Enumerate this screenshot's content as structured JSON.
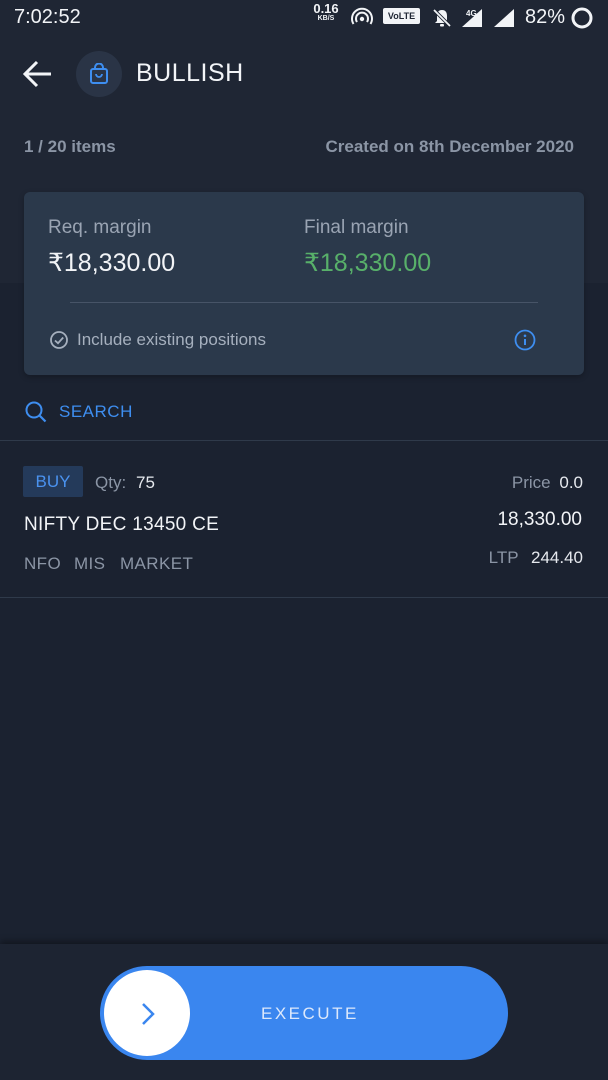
{
  "status_bar": {
    "time": "7:02:52",
    "net_speed_value": "0.16",
    "net_speed_unit": "KB/S",
    "volte": "VoLTE",
    "network_type": "4G",
    "battery_percent": "82%"
  },
  "header": {
    "title": "BULLISH"
  },
  "summary": {
    "items_count": "1 / 20 items",
    "created_on": "Created on 8th December 2020"
  },
  "margin_card": {
    "req_margin_label": "Req. margin",
    "req_margin_value": "₹18,330.00",
    "final_margin_label": "Final margin",
    "final_margin_value": "₹18,330.00",
    "include_positions_label": "Include existing positions"
  },
  "search": {
    "label": "SEARCH"
  },
  "orders": [
    {
      "side": "BUY",
      "qty_label": "Qty:",
      "qty": "75",
      "instrument": "NIFTY DEC 13450 CE",
      "exchange": "NFO",
      "product": "MIS",
      "order_type": "MARKET",
      "price_label": "Price",
      "price": "0.0",
      "amount": "18,330.00",
      "ltp_label": "LTP",
      "ltp": "244.40"
    }
  ],
  "footer": {
    "execute_label": "EXECUTE"
  },
  "colors": {
    "background": "#1b2230",
    "card": "#2b394b",
    "accent_blue": "#3a86ef",
    "final_margin_green": "#58b06a"
  }
}
